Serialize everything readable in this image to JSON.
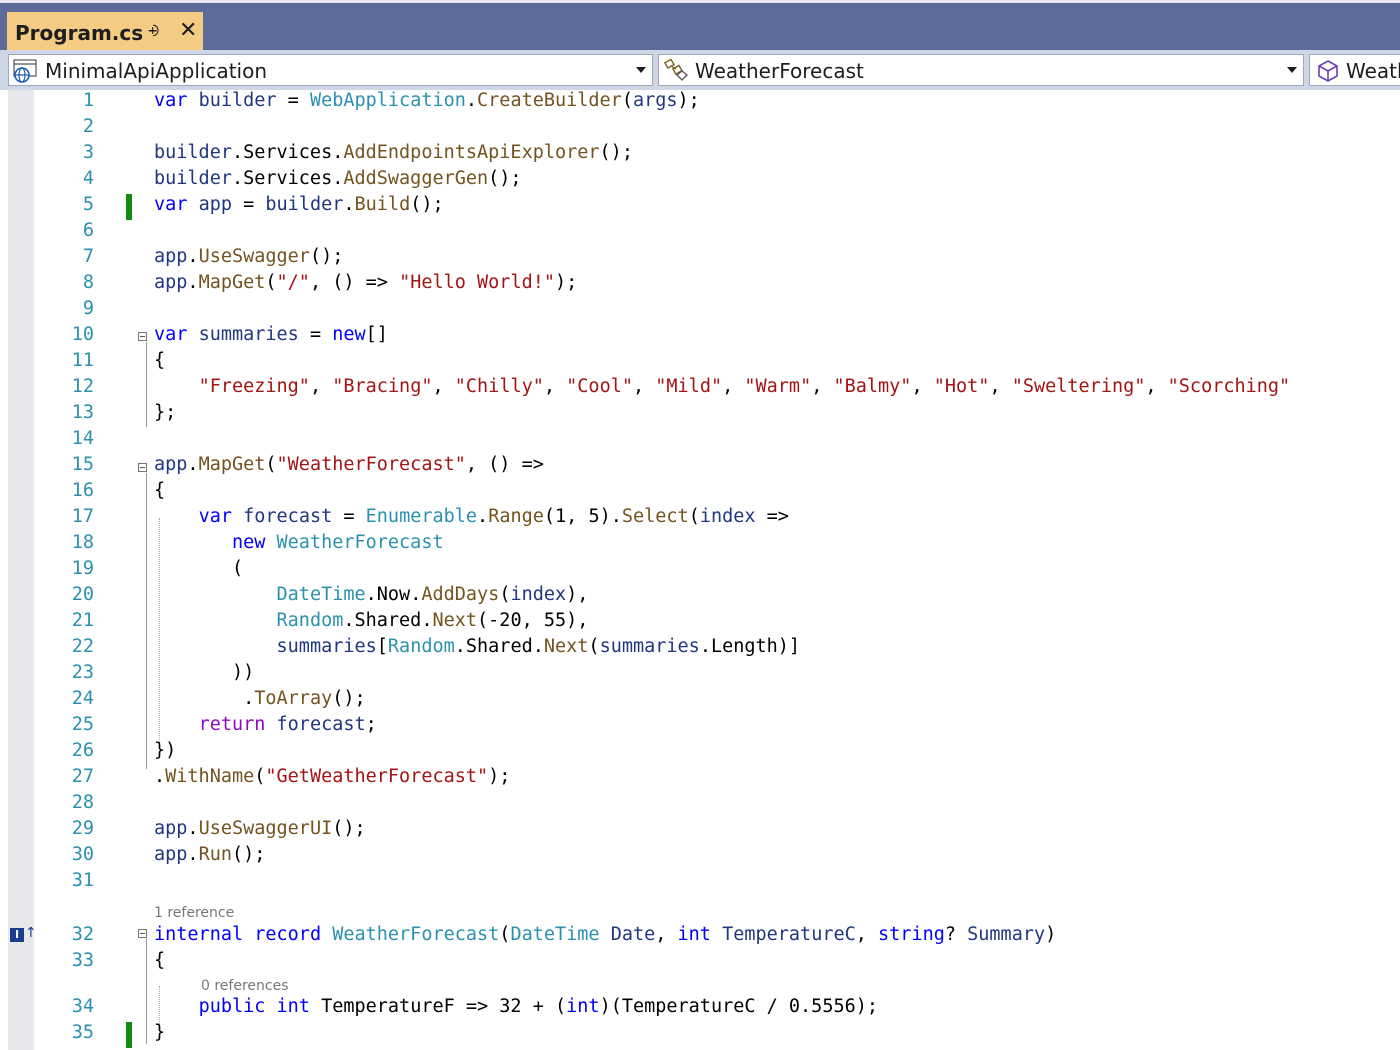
{
  "tab": {
    "title": "Program.cs"
  },
  "navbar": {
    "project": "MinimalApiApplication",
    "type": "WeatherForecast",
    "member": "Weath"
  },
  "lenses": {
    "record": "1 reference",
    "property": "0 references"
  },
  "lines": [
    {
      "n": "1",
      "code": "<span class=\"kw\">var</span> <span class=\"vr\">builder</span> = <span class=\"ty\">WebApplication</span>.<span class=\"mt\">CreateBuilder</span>(<span class=\"vr\">args</span>);"
    },
    {
      "n": "2",
      "code": ""
    },
    {
      "n": "3",
      "code": "<span class=\"vr\">builder</span>.Services.<span class=\"mt\">AddEndpointsApiExplorer</span>();"
    },
    {
      "n": "4",
      "code": "<span class=\"vr\">builder</span>.Services.<span class=\"mt\">AddSwaggerGen</span>();"
    },
    {
      "n": "5",
      "code": "<span class=\"kw\">var</span> <span class=\"vr\">app</span> = <span class=\"vr\">builder</span>.<span class=\"mt\">Build</span>();"
    },
    {
      "n": "6",
      "code": ""
    },
    {
      "n": "7",
      "code": "<span class=\"vr\">app</span>.<span class=\"mt\">UseSwagger</span>();"
    },
    {
      "n": "8",
      "code": "<span class=\"vr\">app</span>.<span class=\"mt\">MapGet</span>(<span class=\"st\">\"/\"</span>, () =&gt; <span class=\"st\">\"Hello World!\"</span>);"
    },
    {
      "n": "9",
      "code": ""
    },
    {
      "n": "10",
      "code": "<span class=\"kw\">var</span> <span class=\"vr\">summaries</span> = <span class=\"kw\">new</span>[]"
    },
    {
      "n": "11",
      "code": "{"
    },
    {
      "n": "12",
      "code": "    <span class=\"st\">\"Freezing\"</span>, <span class=\"st\">\"Bracing\"</span>, <span class=\"st\">\"Chilly\"</span>, <span class=\"st\">\"Cool\"</span>, <span class=\"st\">\"Mild\"</span>, <span class=\"st\">\"Warm\"</span>, <span class=\"st\">\"Balmy\"</span>, <span class=\"st\">\"Hot\"</span>, <span class=\"st\">\"Sweltering\"</span>, <span class=\"st\">\"Scorching\"</span>"
    },
    {
      "n": "13",
      "code": "};"
    },
    {
      "n": "14",
      "code": ""
    },
    {
      "n": "15",
      "code": "<span class=\"vr\">app</span>.<span class=\"mt\">MapGet</span>(<span class=\"st\">\"WeatherForecast\"</span>, () =&gt;"
    },
    {
      "n": "16",
      "code": "{"
    },
    {
      "n": "17",
      "code": "    <span class=\"kw\">var</span> <span class=\"vr\">forecast</span> = <span class=\"ty\">Enumerable</span>.<span class=\"mt\">Range</span>(1, 5).<span class=\"mt\">Select</span>(<span class=\"vr\">index</span> =&gt;"
    },
    {
      "n": "18",
      "code": "       <span class=\"kw\">new</span> <span class=\"ty\">WeatherForecast</span>"
    },
    {
      "n": "19",
      "code": "       ("
    },
    {
      "n": "20",
      "code": "           <span class=\"ty\">DateTime</span>.Now.<span class=\"mt\">AddDays</span>(<span class=\"vr\">index</span>),"
    },
    {
      "n": "21",
      "code": "           <span class=\"ty\">Random</span>.Shared.<span class=\"mt\">Next</span>(-20, 55),"
    },
    {
      "n": "22",
      "code": "           <span class=\"vr\">summaries</span>[<span class=\"ty\">Random</span>.Shared.<span class=\"mt\">Next</span>(<span class=\"vr\">summaries</span>.Length)]"
    },
    {
      "n": "23",
      "code": "       ))"
    },
    {
      "n": "24",
      "code": "        .<span class=\"mt\">ToArray</span>();"
    },
    {
      "n": "25",
      "code": "    <span class=\"ct\">return</span> <span class=\"vr\">forecast</span>;"
    },
    {
      "n": "26",
      "code": "})"
    },
    {
      "n": "27",
      "code": ".<span class=\"mt\">WithName</span>(<span class=\"st\">\"GetWeatherForecast\"</span>);"
    },
    {
      "n": "28",
      "code": ""
    },
    {
      "n": "29",
      "code": "<span class=\"vr\">app</span>.<span class=\"mt\">UseSwaggerUI</span>();"
    },
    {
      "n": "30",
      "code": "<span class=\"vr\">app</span>.<span class=\"mt\">Run</span>();"
    },
    {
      "n": "31",
      "code": ""
    },
    {
      "n": "32",
      "code": "<span class=\"kw\">internal</span> <span class=\"kw\">record</span> <span class=\"ty\">WeatherForecast</span>(<span class=\"ty\">DateTime</span> <span class=\"vr\">Date</span>, <span class=\"kw\">int</span> <span class=\"vr\">TemperatureC</span>, <span class=\"kw\">string</span>? <span class=\"vr\">Summary</span>)"
    },
    {
      "n": "33",
      "code": "{"
    },
    {
      "n": "34",
      "code": "    <span class=\"kw\">public</span> <span class=\"kw\">int</span> TemperatureF =&gt; 32 + (<span class=\"kw\">int</span>)(TemperatureC / 0.5556);"
    },
    {
      "n": "35",
      "code": "}"
    }
  ]
}
